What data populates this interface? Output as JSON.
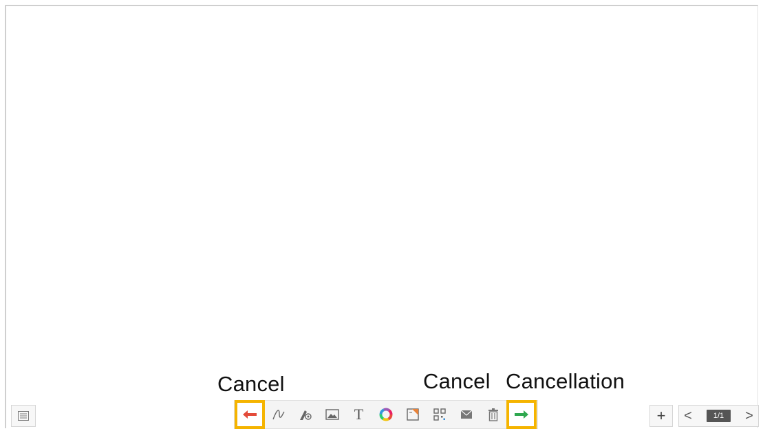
{
  "annotations": {
    "left_label": "Cancel",
    "right_label_1": "Cancel",
    "right_label_2": "Cancellation"
  },
  "toolbar": {
    "tools": [
      {
        "name": "undo-button",
        "icon": "undo-arrow-icon",
        "highlight": true,
        "color": "#e34b3a"
      },
      {
        "name": "pen-button",
        "icon": "pen-icon"
      },
      {
        "name": "eraser-button",
        "icon": "eraser-icon"
      },
      {
        "name": "image-button",
        "icon": "image-icon"
      },
      {
        "name": "text-button",
        "icon": "text-icon",
        "glyph": "T"
      },
      {
        "name": "color-button",
        "icon": "color-wheel-icon"
      },
      {
        "name": "note-button",
        "icon": "note-icon"
      },
      {
        "name": "qr-button",
        "icon": "qr-code-icon"
      },
      {
        "name": "mail-button",
        "icon": "mail-icon"
      },
      {
        "name": "delete-button",
        "icon": "trash-icon"
      },
      {
        "name": "redo-button",
        "icon": "redo-arrow-icon",
        "highlight": true,
        "color": "#2fa84f"
      }
    ],
    "highlight_color": "#f5b400"
  },
  "pager": {
    "prev": "<",
    "next": ">",
    "page": "1/1"
  },
  "add_button": "+"
}
